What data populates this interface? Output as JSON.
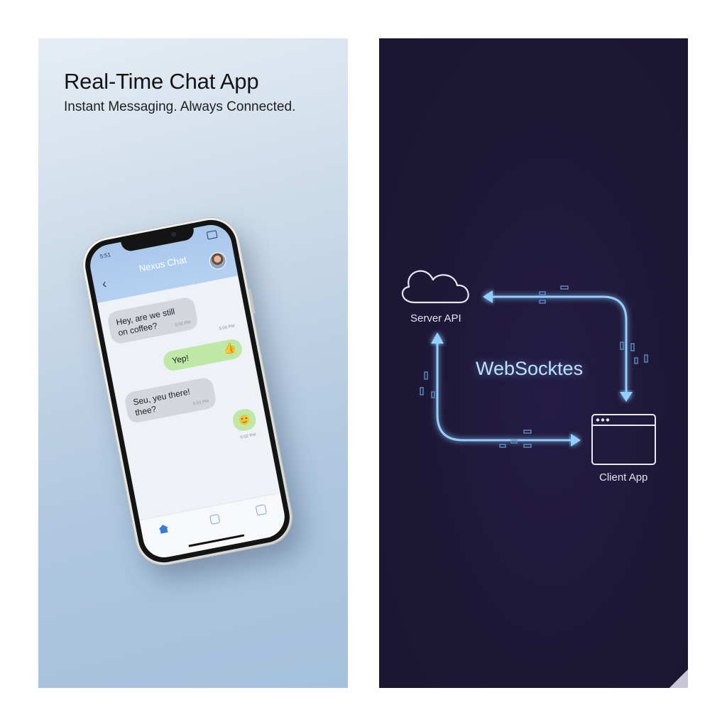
{
  "left": {
    "title": "Real-Time Chat App",
    "subtitle": "Instant Messaging. Always Connected."
  },
  "phone": {
    "status_time": "5:51",
    "chat_title": "Nexus Chat",
    "back_icon": "back-arrow-icon",
    "messages": [
      {
        "direction": "incoming",
        "text": "Hey, are we still on coffee?",
        "time": "5:00 PM"
      },
      {
        "direction": "outgoing",
        "text": "Yep!",
        "icon": "thumbs-up-icon",
        "time": "5:00 PM"
      },
      {
        "direction": "incoming",
        "text": "Seu, yeu there! thee?",
        "time": "5:01 PM"
      },
      {
        "direction": "outgoing",
        "text": "",
        "icon": "smile-emoji-icon",
        "time": "5:02 PM"
      }
    ],
    "tabs": [
      "home-icon",
      "chat-icon",
      "profile-icon"
    ]
  },
  "right": {
    "server_label": "Server API",
    "client_label": "Client App",
    "center_label": "WebSocktes",
    "server_icon": "cloud-icon",
    "client_icon": "browser-window-icon"
  },
  "colors": {
    "right_background": "#1d1836",
    "glow": "#8fd0ff",
    "outgoing_bubble": "#bfe7a6",
    "incoming_bubble": "#d3d7dd"
  }
}
